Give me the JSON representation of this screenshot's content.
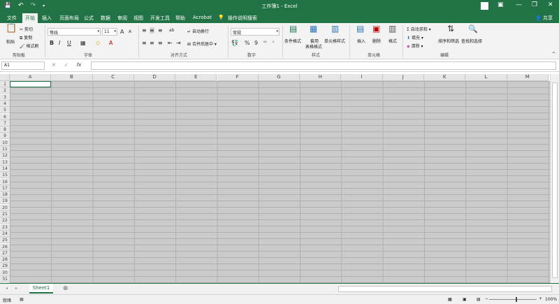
{
  "window": {
    "title": "工作簿1  -  Excel",
    "share_label": "共享",
    "qat": {
      "save": "💾",
      "undo": "↶",
      "redo": "↷",
      "customize": "▾"
    }
  },
  "tabs": [
    {
      "label": "文件",
      "active": false
    },
    {
      "label": "开始",
      "active": true
    },
    {
      "label": "插入",
      "active": false
    },
    {
      "label": "页面布局",
      "active": false
    },
    {
      "label": "公式",
      "active": false
    },
    {
      "label": "数据",
      "active": false
    },
    {
      "label": "审阅",
      "active": false
    },
    {
      "label": "视图",
      "active": false
    },
    {
      "label": "开发工具",
      "active": false
    },
    {
      "label": "帮助",
      "active": false
    },
    {
      "label": "Acrobat",
      "active": false
    }
  ],
  "tell_me": "操作说明搜索",
  "ribbon": {
    "clipboard": {
      "paste": "粘贴",
      "cut": "剪切",
      "copy": "复制",
      "format_painter": "格式刷",
      "group": "剪贴板"
    },
    "font": {
      "name": "等线",
      "size": "11",
      "bold": "B",
      "italic": "I",
      "underline": "U",
      "group": "字体"
    },
    "alignment": {
      "wrap": "自动换行",
      "merge": "合并后居中",
      "group": "对齐方式"
    },
    "number": {
      "format": "常规",
      "percent": "%",
      "comma": "9",
      "group": "数字"
    },
    "styles": {
      "conditional": "条件格式",
      "table": "套用",
      "table2": "表格格式",
      "cell_styles": "单元格样式",
      "group": "样式"
    },
    "cells": {
      "insert": "插入",
      "delete": "删除",
      "format": "格式",
      "group": "单元格"
    },
    "editing": {
      "autosum": "自动求和",
      "fill": "填充",
      "clear": "清除",
      "sort": "排序和筛选",
      "find": "查找和选择",
      "group": "编辑"
    }
  },
  "formula_bar": {
    "name_box": "A1",
    "cancel": "✕",
    "enter": "✓",
    "fx": "fx",
    "value": ""
  },
  "columns": [
    "A",
    "B",
    "C",
    "D",
    "E",
    "F",
    "G",
    "H",
    "I",
    "J",
    "K",
    "L",
    "M"
  ],
  "rows": [
    "1",
    "2",
    "3",
    "4",
    "5",
    "6",
    "7",
    "8",
    "9",
    "10",
    "11",
    "12",
    "13",
    "14",
    "15",
    "16",
    "17",
    "18",
    "19",
    "20",
    "21",
    "22",
    "23",
    "24",
    "25",
    "26",
    "27",
    "28",
    "29",
    "30",
    "31"
  ],
  "sheets": [
    {
      "label": "Sheet1",
      "active": true
    }
  ],
  "add_sheet": "⊕",
  "status": {
    "ready": "就绪",
    "zoom": "100%",
    "zoom_minus": "−",
    "zoom_plus": "+"
  },
  "colors": {
    "accent": "#217346",
    "grid_fill": "#cbcbcb"
  },
  "icons": {
    "ribbon_close": "^",
    "save": "💾",
    "paste": "📋",
    "cut": "✂",
    "copy": "⧉",
    "format_painter": "🖌",
    "increase_font": "A",
    "decrease_font": "A",
    "border": "▦",
    "fill_color": "◇",
    "font_color": "A",
    "align_top": "≡",
    "align_middle": "≡",
    "align_bottom": "≡",
    "orientation": "ab",
    "align_left": "≡",
    "align_center": "≡",
    "align_right": "≡",
    "decrease_indent": "⇤",
    "increase_indent": "⇥",
    "wrap": "↵",
    "merge": "⊞",
    "currency": "💱",
    "comma_style": "9",
    "inc_decimal": "⁰⁰",
    "dec_decimal": "⁰",
    "conditional": "▤",
    "table": "▦",
    "cell_styles": "▥",
    "insert": "▤",
    "delete": "▣",
    "format": "▥",
    "sum": "Σ",
    "fill": "⬇",
    "clear": "◆",
    "sort": "⇅",
    "find": "🔍",
    "tell_me": "💡",
    "minimize": "—",
    "restore": "❐",
    "close": "✕",
    "ribbon_display": "▣",
    "prev_sheet": "◂",
    "next_sheet": "▸",
    "normal_view": "▦",
    "page_layout": "▣",
    "page_break": "▤"
  }
}
